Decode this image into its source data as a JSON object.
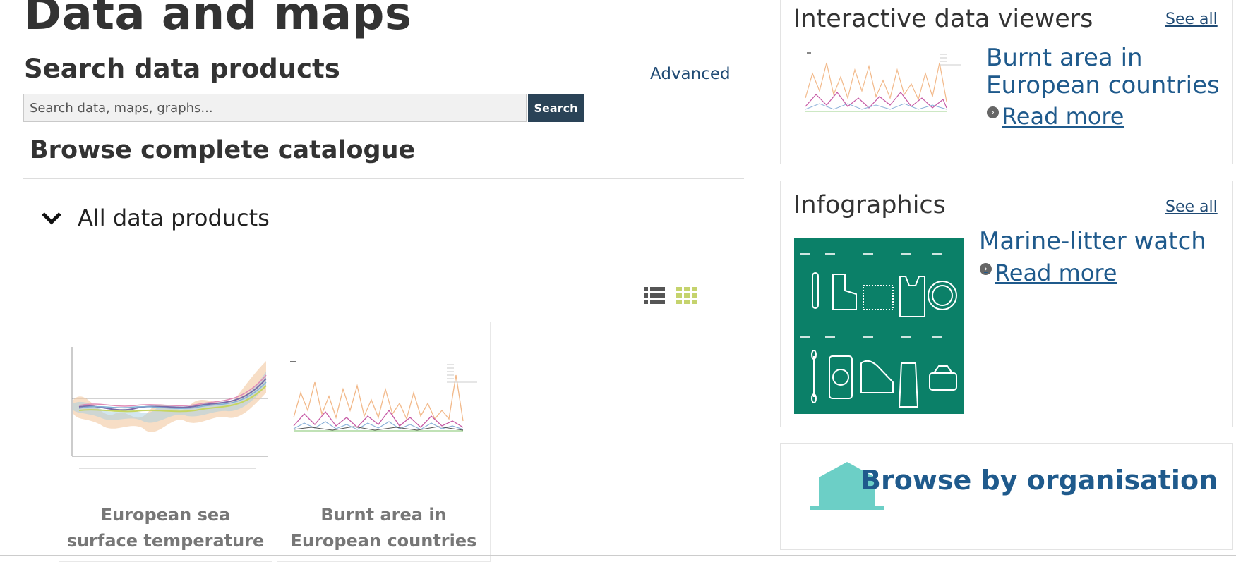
{
  "header": {
    "title": "Data and maps"
  },
  "search": {
    "title": "Search data products",
    "advanced_label": "Advanced",
    "placeholder": "Search data, maps, graphs...",
    "button_label": "Search"
  },
  "catalogue": {
    "title": "Browse complete catalogue",
    "toggle_label": "All data products",
    "view_icons": [
      "list-view-icon",
      "grid-view-icon"
    ],
    "active_view_color": "#c5d36d"
  },
  "cards": [
    {
      "title": "European sea surface temperature"
    },
    {
      "title": "Burnt area in European countries"
    }
  ],
  "sidebar": {
    "viewers": {
      "title": "Interactive data viewers",
      "see_all": "See all",
      "item_title": "Burnt area in European countries",
      "read_more": "Read more"
    },
    "infographics": {
      "title": "Infographics",
      "see_all": "See all",
      "item_title": "Marine-litter watch",
      "read_more": "Read more",
      "thumb_color": "#0b8068"
    },
    "organisation": {
      "title": "Browse by organisation",
      "icon": "building-icon",
      "icon_color": "#6ccfc6"
    }
  },
  "colors": {
    "link": "#1f5a8c",
    "button": "#2a4357"
  }
}
